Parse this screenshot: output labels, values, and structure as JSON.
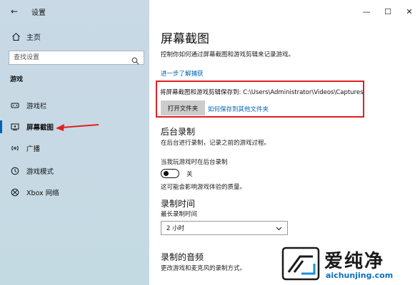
{
  "window": {
    "title": "设置",
    "back_label": "←",
    "controls": [
      "—",
      "☐",
      "✕"
    ]
  },
  "sidebar": {
    "home_label": "主页",
    "search_placeholder": "查找设置",
    "section_label": "游戏",
    "items": [
      {
        "label": "游戏栏",
        "icon": "game-bar-icon"
      },
      {
        "label": "屏幕截图",
        "icon": "captures-icon",
        "active": true
      },
      {
        "label": "广播",
        "icon": "broadcast-icon"
      },
      {
        "label": "游戏模式",
        "icon": "game-mode-icon"
      },
      {
        "label": "Xbox 网络",
        "icon": "xbox-icon"
      }
    ]
  },
  "main": {
    "title": "屏幕截图",
    "subtitle": "控制你如何通过屏幕截图和游戏剪辑来记录游戏。",
    "learn_more": "进一步了解捕获",
    "save_path_label": "将屏幕截图和游戏剪辑保存到: C:\\Users\\Administrator\\Videos\\Captures",
    "open_folder_button": "打开文件夹",
    "save_elsewhere_link": "如何保存到其他文件夹",
    "background": {
      "heading": "后台录制",
      "description": "在后台进行录制，记录之前的游戏过程。",
      "toggle_caption": "当我玩游戏时在后台录制",
      "toggle_state": "关",
      "note": "这可能会影响游戏体验的质量。"
    },
    "record_time": {
      "heading": "录制时间",
      "label": "最长录制时间",
      "selected": "2 小时"
    },
    "audio": {
      "heading": "录制的音频",
      "description": "更改游戏和麦克风的录制方式。"
    }
  },
  "watermark": {
    "brand": "爱纯净",
    "url": "aichunjing.com"
  },
  "colors": {
    "accent": "#0063b1",
    "highlight_box": "#e02020",
    "sidebar_bg": "#c7d9e4"
  }
}
